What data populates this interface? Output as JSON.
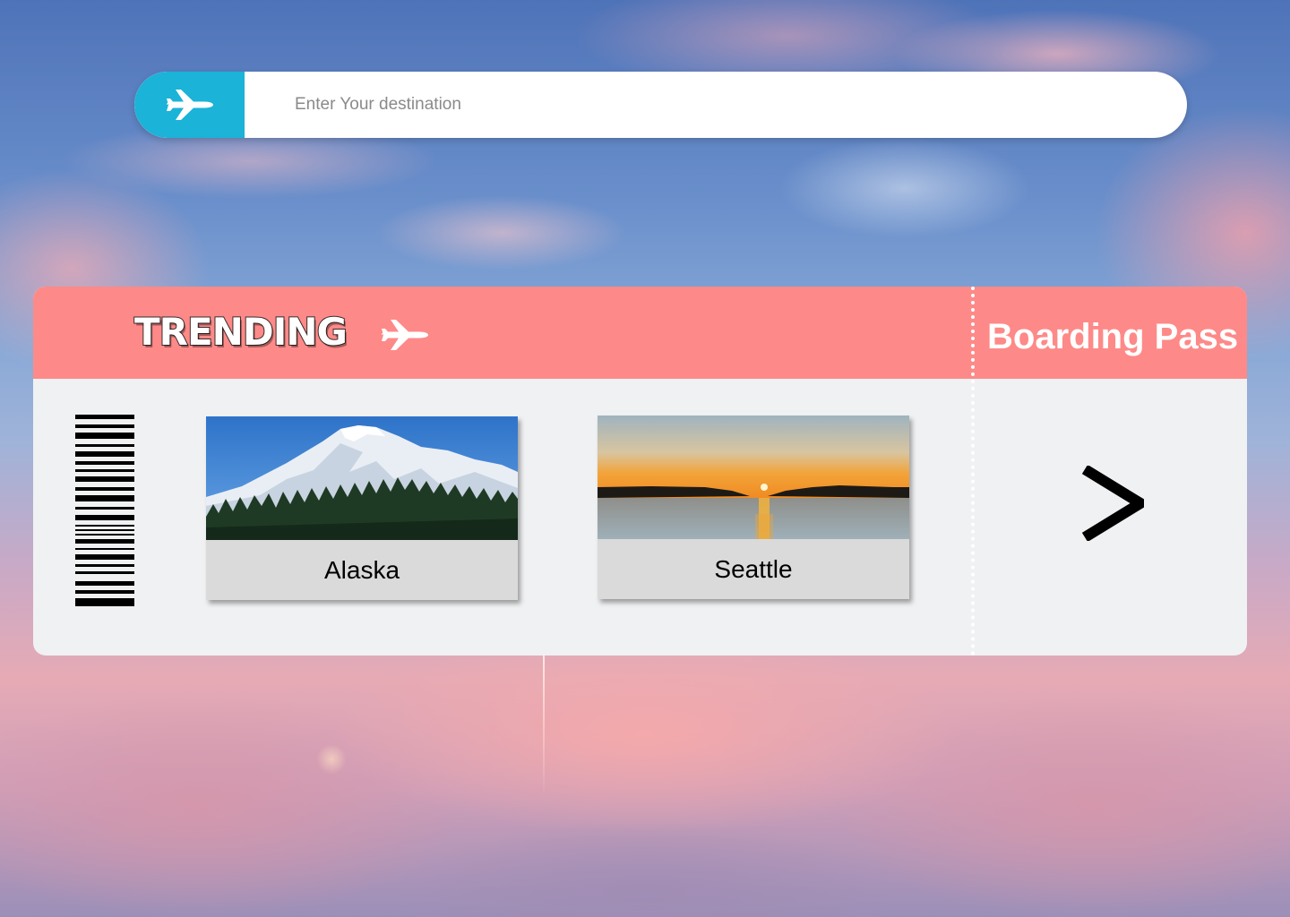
{
  "search": {
    "placeholder": "Enter Your destination",
    "value": "",
    "button_icon": "airplane-icon",
    "button_color": "#1bb3d7"
  },
  "ticket": {
    "header_color": "#fd8a88",
    "body_color": "#f0f1f3",
    "trending_label": "TRENDING",
    "trending_icon": "airplane-icon",
    "stub_label": "Boarding Pass",
    "next_icon": "chevron-right-icon",
    "destinations": [
      {
        "name": "Alaska",
        "image": "snowy-mountain-forest"
      },
      {
        "name": "Seattle",
        "image": "sunset-over-water"
      }
    ]
  }
}
